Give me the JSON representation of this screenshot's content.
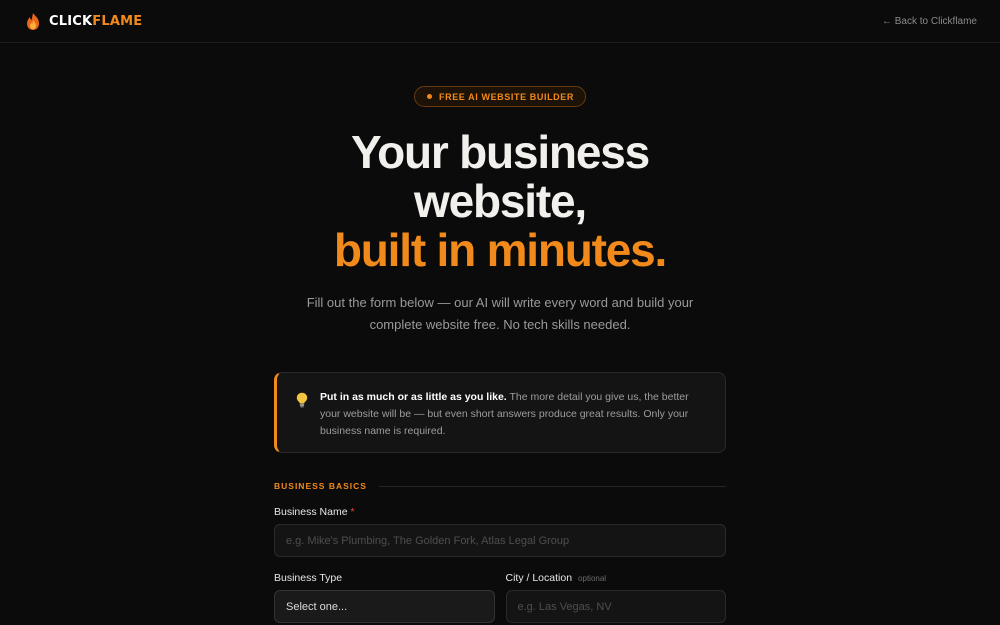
{
  "header": {
    "brand_part1": "CLICK",
    "brand_part2": "FLAME",
    "back_link": "← Back to Clickflame"
  },
  "hero": {
    "badge": "FREE AI WEBSITE BUILDER",
    "headline_line1": "Your business",
    "headline_line2": "website,",
    "headline_line3": "built in minutes.",
    "subtitle": "Fill out the form below — our AI will write every word and build your complete website free. No tech skills needed."
  },
  "tip": {
    "icon": "lightbulb-icon",
    "bold": "Put in as much or as little as you like.",
    "body": " The more detail you give us, the better your website will be — but even short answers produce great results. Only your business name is required."
  },
  "form": {
    "section_label": "BUSINESS BASICS",
    "business_name": {
      "label": "Business Name",
      "required_mark": "*",
      "placeholder": "e.g. Mike's Plumbing, The Golden Fork, Atlas Legal Group",
      "value": ""
    },
    "business_type": {
      "label": "Business Type",
      "selected": "Select one..."
    },
    "city": {
      "label": "City / Location",
      "optional": "optional",
      "placeholder": "e.g. Las Vegas, NV",
      "value": ""
    }
  },
  "colors": {
    "accent": "#f28a1b",
    "background": "#0b0b0b",
    "required": "#f0453a"
  }
}
